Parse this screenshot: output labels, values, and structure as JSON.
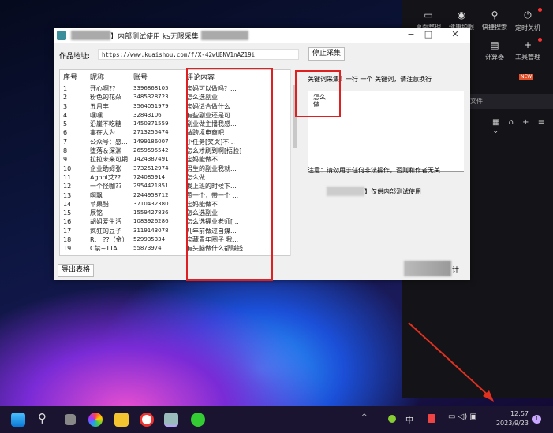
{
  "side_panel": {
    "items": [
      {
        "label": "桌面整理",
        "icon": "monitor-icon"
      },
      {
        "label": "健康护眼",
        "icon": "eye-icon"
      },
      {
        "label": "快捷搜索",
        "icon": "search-icon"
      },
      {
        "label": "定时关机",
        "icon": "power-icon"
      },
      {
        "label": "计算器",
        "icon": "calculator-icon"
      },
      {
        "label": "工具管理",
        "icon": "plus-icon"
      }
    ],
    "new_badge": "NEW",
    "file_label": "文件"
  },
  "window": {
    "title": "】内部测试使用 ks无限采集",
    "url_label": "作品地址:",
    "url_value": "https://www.kuaishou.com/f/X-42wUBNV1nAZ19i",
    "stop_button": "停止采集",
    "export_button": "导出表格",
    "bottom_right_button": "计",
    "columns": [
      "序号",
      "昵称",
      "账号",
      "评论内容"
    ],
    "rows": [
      [
        "1",
        "开心啊??",
        "3396868105",
        "宝妈可以做吗？..."
      ],
      [
        "2",
        "粉色的花朵",
        "3485328723",
        "怎么选副业"
      ],
      [
        "3",
        "五月丰",
        "3564051979",
        "宝妈适合做什么"
      ],
      [
        "4",
        "嘿嘿",
        "32843106",
        "有些副业还是可..."
      ],
      [
        "5",
        "沿崖不吃糖",
        "1450371559",
        "副业做主播我感..."
      ],
      [
        "6",
        "事在人为",
        "2713255474",
        "做跨境电商吧"
      ],
      [
        "7",
        "公众号：感...",
        "1499186007",
        "小任务[笑哭]不..."
      ],
      [
        "8",
        "堕落＆深渊",
        "2659595542",
        "怎么才刷到啊[捂脸]"
      ],
      [
        "9",
        "拉拉未来可期",
        "1424387491",
        "宝妈能做不"
      ],
      [
        "10",
        "企业助姆张",
        "3732512974",
        "男生的副业我就..."
      ],
      [
        "11",
        "Agoni艾??",
        "724085914",
        "怎么做"
      ],
      [
        "12",
        "一个怪咖??",
        "2954421851",
        "我上班的时候下..."
      ],
      [
        "13",
        "啊飘",
        "2244958712",
        "赞一个，带一个 ..."
      ],
      [
        "14",
        "苹果醋",
        "3710432380",
        "宝妈能做不"
      ],
      [
        "15",
        "辰铭",
        "1559427836",
        "怎么选副业"
      ],
      [
        "16",
        "胡姐爱生活",
        "1083926286",
        "怎么选福业老师[..."
      ],
      [
        "17",
        "疯狂的豆子",
        "3119143078",
        "几年前做过自媒..."
      ],
      [
        "18",
        "R、 ??（金）",
        "529935334",
        "宝藏青年圈子 我..."
      ],
      [
        "19",
        "C禁~TTA",
        "55873974",
        "有头脑做什么都赚钱"
      ]
    ],
    "keyword_label": "关键词采集！一行 一个 关键词，请注意换行",
    "keywords": "怎么\n做",
    "notice": "注意：请勿用于任何非法操作，否则和作者无关",
    "internal_note": "】仅供内部测试使用"
  },
  "taskbar": {
    "time": "12:57",
    "date": "2023/9/23",
    "ime": "中",
    "notifications": "1"
  }
}
